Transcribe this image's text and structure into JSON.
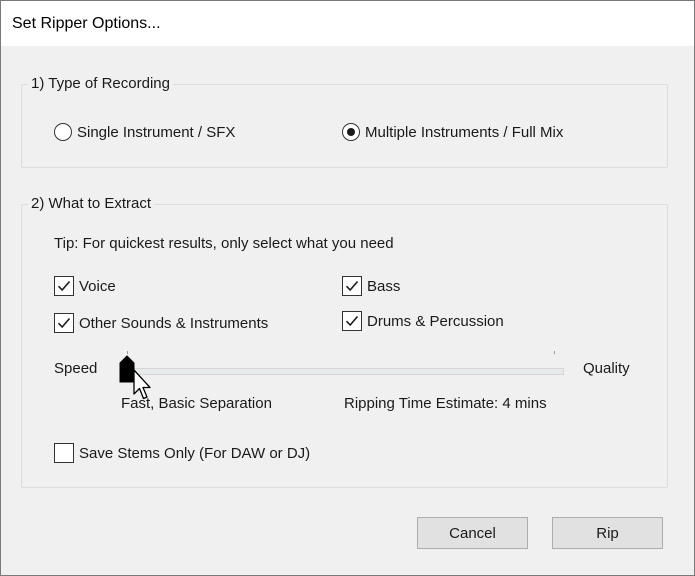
{
  "window": {
    "title": "Set Ripper Options..."
  },
  "recording": {
    "legend": "1) Type of Recording",
    "options": [
      {
        "label": "Single Instrument / SFX",
        "selected": false
      },
      {
        "label": "Multiple Instruments / Full Mix",
        "selected": true
      }
    ]
  },
  "extract": {
    "legend": "2) What to Extract",
    "tip": "Tip: For quickest results, only select what you need",
    "items": [
      {
        "label": "Voice",
        "checked": true
      },
      {
        "label": "Bass",
        "checked": true
      },
      {
        "label": "Other Sounds & Instruments",
        "checked": true
      },
      {
        "label": "Drums & Percussion",
        "checked": true
      }
    ],
    "slider": {
      "left_label": "Speed",
      "right_label": "Quality",
      "value": 0,
      "value_label": "Fast, Basic Separation"
    },
    "estimate": "Ripping Time Estimate: 4 mins",
    "stems_only": {
      "label": "Save Stems Only (For DAW or DJ)",
      "checked": false
    }
  },
  "buttons": {
    "cancel": "Cancel",
    "rip": "Rip"
  }
}
